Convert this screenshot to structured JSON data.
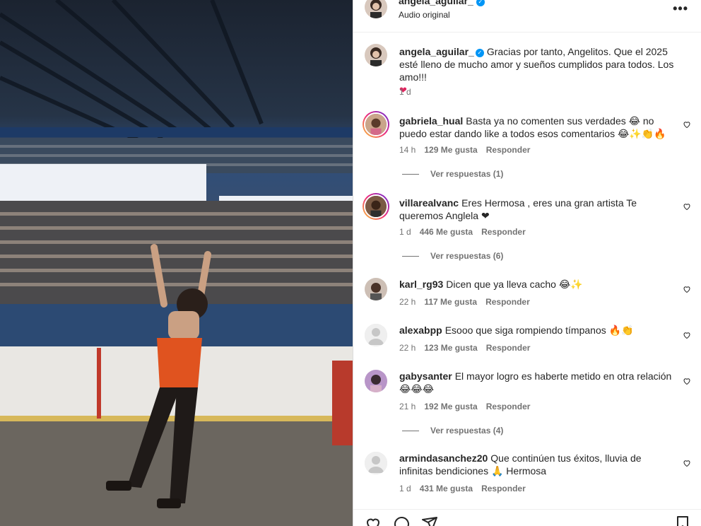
{
  "post": {
    "username": "angela_aguilar_",
    "audio": "Audio original",
    "caption": "Gracias por tanto, Angelitos. Que el 2025 esté lleno de mucho amor y sueños cumplidos para todos. Los amo!!!",
    "caption_emoji": "❤",
    "age": "1 d"
  },
  "more_icon": "more-horizontal-icon",
  "comments": [
    {
      "user": "gabriela_hual",
      "text": "Basta ya no comenten sus verdades 😂 no puedo estar dando like a todos esos comentarios 😂✨👏🔥",
      "time": "14 h",
      "likes": "129 Me gusta",
      "reply": "Responder",
      "replies": "Ver respuestas (1)"
    },
    {
      "user": "villarealvanc",
      "text": "Eres Hermosa , eres una gran artista Te queremos Anglela ❤",
      "time": "1 d",
      "likes": "446 Me gusta",
      "reply": "Responder",
      "replies": "Ver respuestas (6)"
    },
    {
      "user": "karl_rg93",
      "text": "Dicen que ya lleva cacho 😂✨",
      "time": "22 h",
      "likes": "117 Me gusta",
      "reply": "Responder"
    },
    {
      "user": "alexabpp",
      "text": "Esooo que siga rompiendo tímpanos 🔥👏",
      "time": "22 h",
      "likes": "123 Me gusta",
      "reply": "Responder"
    },
    {
      "user": "gabysanter",
      "text": "El mayor logro es haberte metido en otra relación 😂😂😂",
      "time": "21 h",
      "likes": "192 Me gusta",
      "reply": "Responder",
      "replies": "Ver respuestas (4)"
    },
    {
      "user": "armindasanchez20",
      "text": "Que continúen tus éxitos, lluvia de infinitas bendiciones 🙏 Hermosa",
      "time": "1 d",
      "likes": "431 Me gusta",
      "reply": "Responder"
    }
  ],
  "action_icons": [
    "heart-icon",
    "comment-icon",
    "share-icon",
    "bookmark-icon"
  ]
}
